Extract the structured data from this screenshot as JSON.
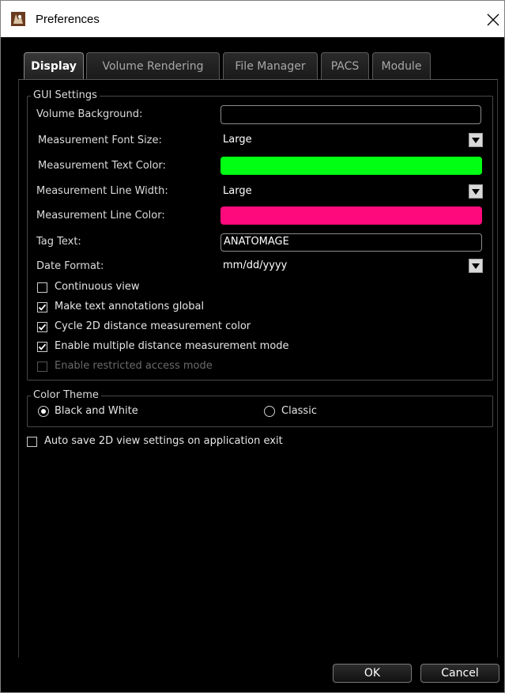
{
  "window": {
    "title": "Preferences",
    "close_symbol": "✕"
  },
  "tabs": [
    {
      "label": "Display",
      "active": true
    },
    {
      "label": "Volume Rendering",
      "active": false
    },
    {
      "label": "File Manager",
      "active": false
    },
    {
      "label": "PACS",
      "active": false
    },
    {
      "label": "Module",
      "active": false
    }
  ],
  "gui_settings": {
    "group_title": "GUI Settings",
    "volume_background_label": "Volume Background:",
    "volume_background_value": "",
    "font_size_label": "Measurement Font Size:",
    "font_size_value": "Large",
    "text_color_label": "Measurement Text Color:",
    "text_color": "#00ff12",
    "line_width_label": "Measurement Line Width:",
    "line_width_value": "Large",
    "line_color_label": "Measurement Line Color:",
    "line_color": "#ff0a7c",
    "tag_text_label": "Tag Text:",
    "tag_text_value": "ANATOMAGE",
    "date_format_label": "Date Format:",
    "date_format_value": "mm/dd/yyyy",
    "checkboxes": [
      {
        "label": "Continuous view",
        "checked": false,
        "enabled": true
      },
      {
        "label": "Make text annotations global",
        "checked": true,
        "enabled": true
      },
      {
        "label": "Cycle 2D distance measurement color",
        "checked": true,
        "enabled": true
      },
      {
        "label": "Enable multiple distance measurement mode",
        "checked": true,
        "enabled": true
      },
      {
        "label": "Enable restricted access mode",
        "checked": false,
        "enabled": false
      }
    ]
  },
  "color_theme": {
    "group_title": "Color Theme",
    "options": [
      {
        "label": "Black and White",
        "selected": true
      },
      {
        "label": "Classic",
        "selected": false
      }
    ]
  },
  "auto_save": {
    "label": "Auto save 2D view settings on application exit",
    "checked": false
  },
  "buttons": {
    "ok": "OK",
    "cancel": "Cancel"
  },
  "icons": {
    "app": "app-logo-icon",
    "close": "close-icon",
    "dropdown": "chevron-down-icon",
    "check": "checkmark-icon"
  }
}
